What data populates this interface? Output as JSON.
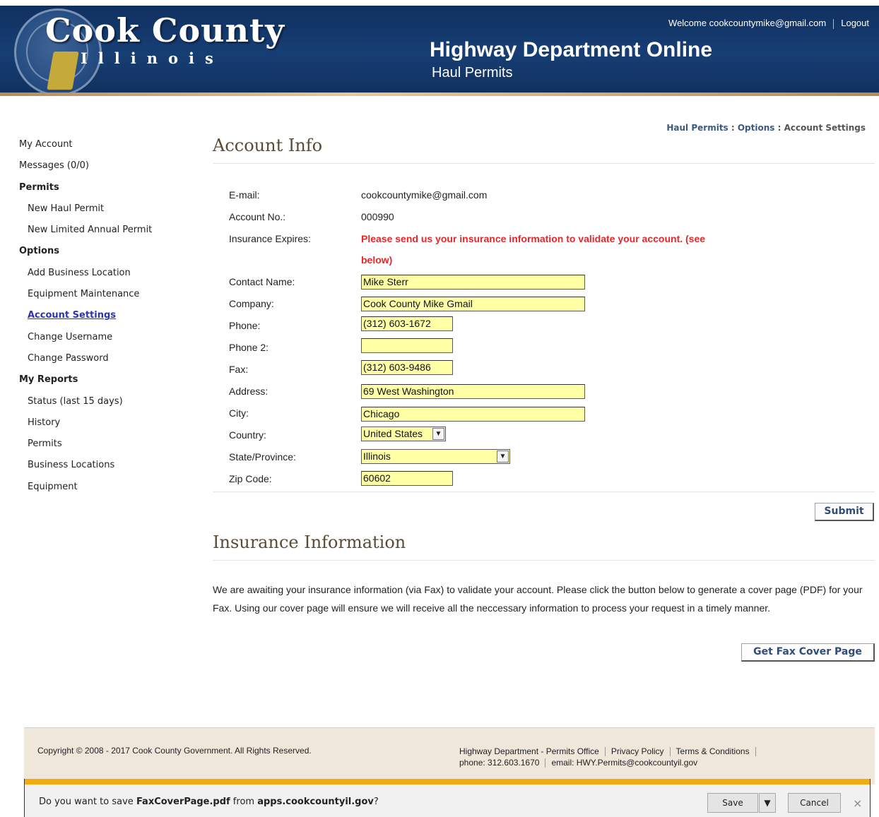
{
  "header": {
    "logo_main": "Cook County",
    "logo_sub": "Illinois",
    "dept_title": "Highway Department Online",
    "dept_subtitle": "Haul Permits",
    "welcome": "Welcome cookcountymike@gmail.com",
    "logout": "Logout"
  },
  "sidebar": {
    "items": [
      {
        "label": "My Account",
        "kind": "top"
      },
      {
        "label": "Messages (0/0)",
        "kind": "top"
      },
      {
        "label": "Permits",
        "kind": "section"
      },
      {
        "label": "New Haul Permit",
        "kind": "sub"
      },
      {
        "label": "New Limited Annual Permit",
        "kind": "sub"
      },
      {
        "label": "Options",
        "kind": "section"
      },
      {
        "label": "Add Business Location",
        "kind": "sub"
      },
      {
        "label": "Equipment Maintenance",
        "kind": "sub"
      },
      {
        "label": "Account Settings",
        "kind": "sub-active"
      },
      {
        "label": "Change Username",
        "kind": "sub"
      },
      {
        "label": "Change Password",
        "kind": "sub"
      },
      {
        "label": "My Reports",
        "kind": "section"
      },
      {
        "label": "Status (last 15 days)",
        "kind": "sub"
      },
      {
        "label": "History",
        "kind": "sub"
      },
      {
        "label": "Permits",
        "kind": "sub"
      },
      {
        "label": "Business Locations",
        "kind": "sub"
      },
      {
        "label": "Equipment",
        "kind": "sub"
      }
    ]
  },
  "breadcrumb": {
    "crumb1": "Haul Permits",
    "sep": " : ",
    "crumb2": "Options",
    "current": "Account Settings"
  },
  "account": {
    "heading": "Account Info",
    "email_label": "E-mail:",
    "email_value": "cookcountymike@gmail.com",
    "account_no_label": "Account No.:",
    "account_no_value": "000990",
    "insurance_label": "Insurance Expires:",
    "insurance_warning_line1": "Please send us your insurance information to validate your account. (see",
    "insurance_warning_line2": "below)",
    "contact_label": "Contact Name:",
    "contact_value": "Mike Sterr",
    "company_label": "Company:",
    "company_value": "Cook County Mike Gmail",
    "phone_label": "Phone:",
    "phone_value": "(312) 603-1672",
    "phone2_label": "Phone 2:",
    "phone2_value": "",
    "fax_label": "Fax:",
    "fax_value": "(312) 603-9486",
    "address_label": "Address:",
    "address_value": "69 West Washington",
    "city_label": "City:",
    "city_value": "Chicago",
    "country_label": "Country:",
    "country_value": "United States",
    "state_label": "State/Province:",
    "state_value": "Illinois",
    "zip_label": "Zip Code:",
    "zip_value": "60602",
    "submit_label": "Submit"
  },
  "insurance": {
    "heading": "Insurance Information",
    "text": "We are awaiting your insurance information (via Fax) to validate your account. Please click the button below to generate a cover page (PDF) for your Fax. Using our cover page will ensure we will receive all the neccessary information to process your request in a timely manner.",
    "button_label": "Get Fax Cover Page"
  },
  "footer": {
    "copyright": "Copyright © 2008 - 2017 Cook County Government. All Rights Reserved.",
    "office": "Highway Department - Permits Office",
    "privacy": "Privacy Policy",
    "terms": "Terms & Conditions",
    "phone": "phone: 312.603.1670",
    "email": "email: HWY.Permits@cookcountyil.gov"
  },
  "download_bar": {
    "prefix": "Do you want to save ",
    "filename": "FaxCoverPage.pdf",
    "middle": " from ",
    "domain": "apps.cookcountyil.gov",
    "suffix": "?",
    "save_label": "Save",
    "cancel_label": "Cancel",
    "close_symbol": "×"
  },
  "colors": {
    "header_blue": "#173e74",
    "input_yellow": "#ffffa6",
    "warning_red": "#e8272a",
    "active_link": "#2b34b5",
    "download_accent": "#f2ab0f"
  }
}
